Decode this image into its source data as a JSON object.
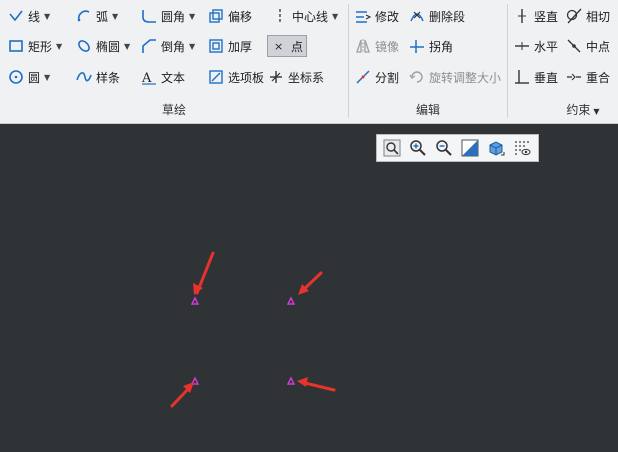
{
  "ribbon": {
    "sketch": {
      "label": "草绘",
      "row1": {
        "line": "线",
        "arc": "弧",
        "fillet": "圆角",
        "offset": "偏移",
        "centerline": "中心线"
      },
      "row2": {
        "rectangle": "矩形",
        "ellipse": "椭圆",
        "chamfer": "倒角",
        "thicken": "加厚",
        "point": "点"
      },
      "row3": {
        "circle": "圆",
        "spline": "样条",
        "text": "文本",
        "palette": "选项板",
        "coordsys": "坐标系"
      }
    },
    "edit": {
      "label": "编辑",
      "modify": "修改",
      "delete_segment": "删除段",
      "mirror": "镜像",
      "corner": "拐角",
      "divide": "分割",
      "rotate_resize": "旋转调整大小"
    },
    "constrain": {
      "label": "约束",
      "vertical": "竖直",
      "tangent": "相切",
      "horizontal": "水平",
      "midpoint": "中点",
      "perpendicular": "垂直",
      "coincident": "重合"
    }
  },
  "view_toolbar": [
    "refit-icon",
    "zoom-in-icon",
    "zoom-out-icon",
    "repaint-icon",
    "display-style-icon",
    "sketch-display-filter-icon"
  ],
  "colors": {
    "canvas": "#2f3336",
    "ribbon": "#f0f1f3",
    "point": "#d13ad6",
    "arrow": "#e8322c"
  }
}
